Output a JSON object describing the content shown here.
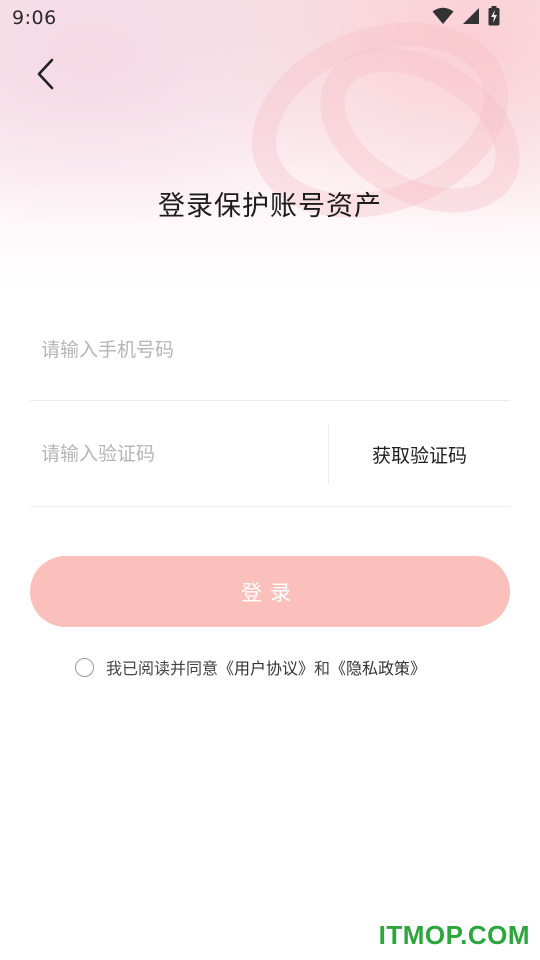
{
  "status_bar": {
    "time": "9:06",
    "icons": [
      "wifi-icon",
      "cell-signal-icon",
      "battery-charging-icon"
    ]
  },
  "header": {
    "back_icon": "chevron-left-icon",
    "title": "登录保护账号资产"
  },
  "form": {
    "phone": {
      "placeholder": "请输入手机号码",
      "value": ""
    },
    "code": {
      "placeholder": "请输入验证码",
      "value": ""
    },
    "get_code_label": "获取验证码",
    "login_label": "登录"
  },
  "agreement": {
    "prefix": "我已阅读并同意",
    "user_agreement": "《用户协议》",
    "conjunction": "和",
    "privacy_policy": "《隐私政策》",
    "checked": false
  },
  "watermark": "ITMOP.COM",
  "colors": {
    "login_button": "#fbbfbc",
    "hero_tint": "#f8e4ea",
    "watermark": "#2aa63a"
  }
}
